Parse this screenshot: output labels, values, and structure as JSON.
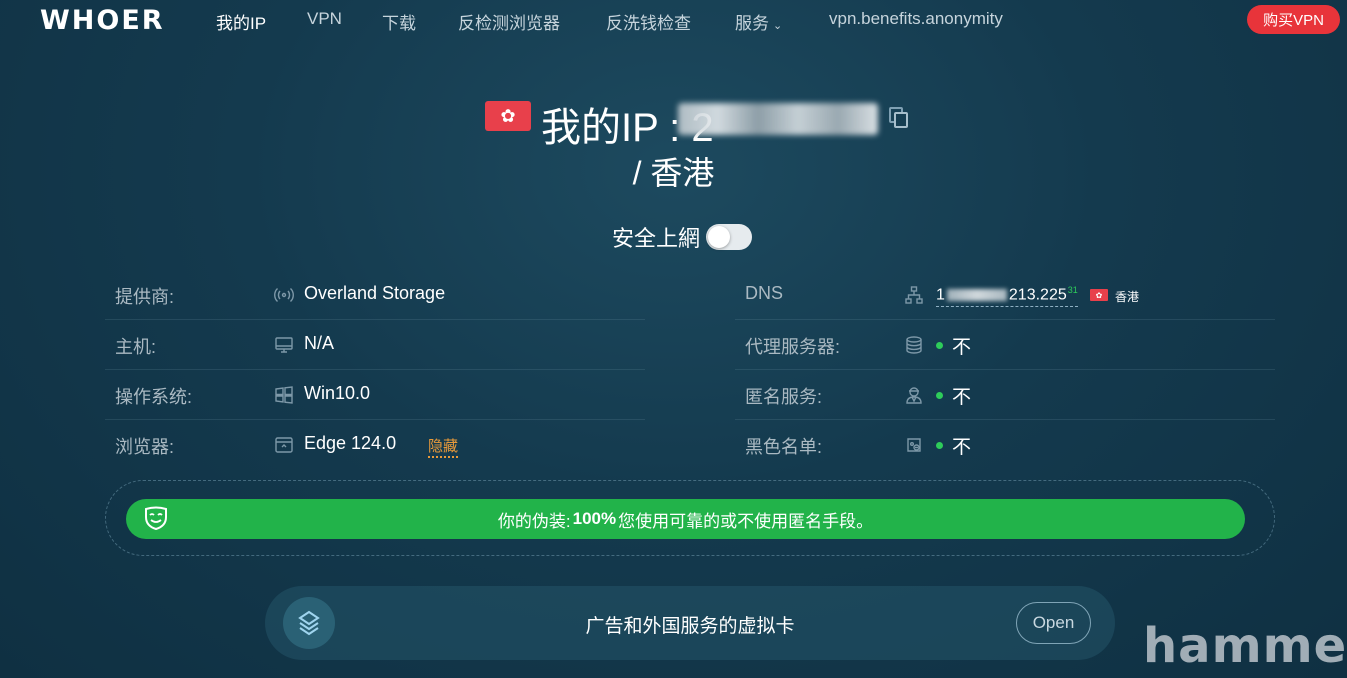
{
  "nav": {
    "logo": "WHOER",
    "links": [
      {
        "label": "我的IP"
      },
      {
        "label": "VPN"
      },
      {
        "label": "下载"
      },
      {
        "label": "反检测浏览器"
      },
      {
        "label": "反洗钱检查"
      },
      {
        "label": "服务"
      },
      {
        "label": "vpn.benefits.anonymity"
      }
    ],
    "buy_label": "购买VPN"
  },
  "hero": {
    "title_prefix": "我的IP : 2",
    "location": "/ 香港"
  },
  "secure": {
    "label": "安全上網",
    "toggle_on": false
  },
  "left_rows": [
    {
      "label": "提供商:",
      "icon": "broadcast-icon",
      "value": "Overland Storage"
    },
    {
      "label": "主机:",
      "icon": "monitor-icon",
      "value": "N/A"
    },
    {
      "label": "操作系统:",
      "icon": "windows-icon",
      "value": "Win10.0"
    },
    {
      "label": "浏览器:",
      "icon": "browser-icon",
      "value": "Edge 124.0",
      "extra": "隐藏"
    }
  ],
  "right_rows": [
    {
      "label": "DNS",
      "icon": "network-icon",
      "value_prefix": "1",
      "value_suffix": "213.225",
      "sup": "31",
      "country": "香港"
    },
    {
      "label": "代理服务器:",
      "icon": "database-icon",
      "value": "不"
    },
    {
      "label": "匿名服务:",
      "icon": "user-secret-icon",
      "value": "不"
    },
    {
      "label": "黑色名单:",
      "icon": "blacklist-icon",
      "value": "不"
    }
  ],
  "disguise": {
    "prefix": "你的伪装:",
    "percent": "100%",
    "text": "您使用可靠的或不使用匿名手段。"
  },
  "promo": {
    "text": "广告和外国服务的虚拟卡",
    "button": "Open"
  },
  "watermark": "hammer",
  "colors": {
    "background": "#143a4e",
    "accent_red": "#e8343a",
    "success_green": "#22b34a",
    "warning_orange": "#e89a3a"
  }
}
